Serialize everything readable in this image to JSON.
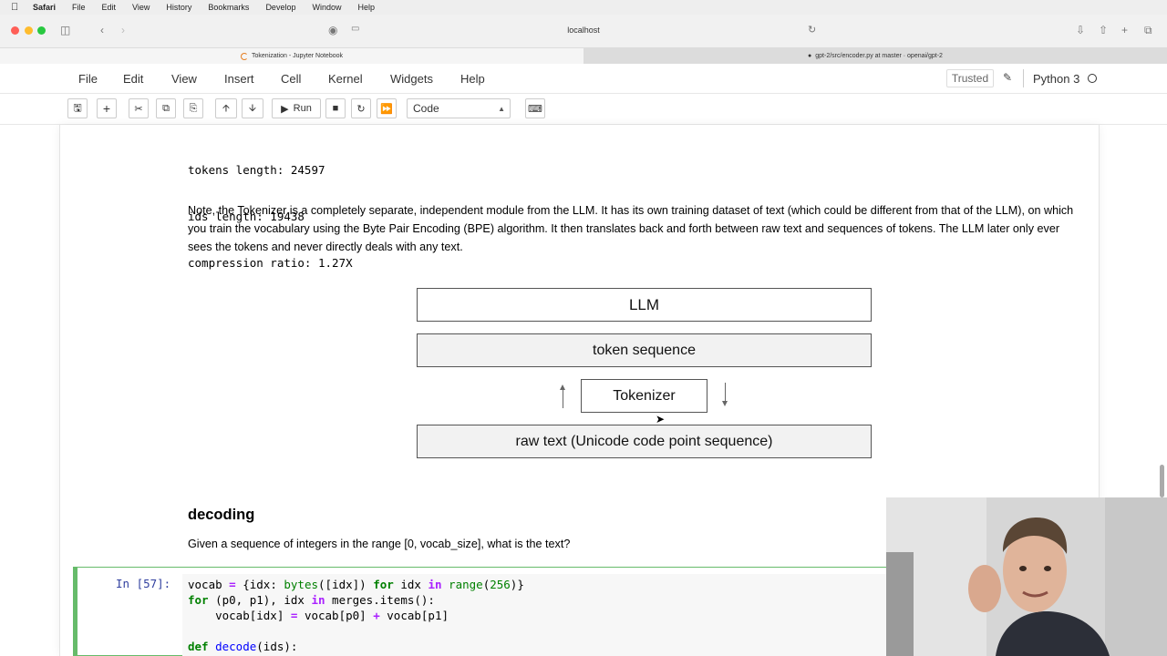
{
  "menubar": {
    "app": "Safari",
    "items": [
      "File",
      "Edit",
      "View",
      "History",
      "Bookmarks",
      "Develop",
      "Window",
      "Help"
    ]
  },
  "browser": {
    "url": "localhost",
    "tabs": [
      {
        "title": "Tokenization - Jupyter Notebook"
      },
      {
        "title": "gpt-2/src/encoder.py at master · openai/gpt-2"
      }
    ]
  },
  "jupyter": {
    "menu": [
      "File",
      "Edit",
      "View",
      "Insert",
      "Cell",
      "Kernel",
      "Widgets",
      "Help"
    ],
    "trusted": "Trusted",
    "kernel": "Python 3",
    "run_label": "Run",
    "cell_type": "Code"
  },
  "output": {
    "lines": [
      "tokens length: 24597",
      "ids length: 19438",
      "compression ratio: 1.27X"
    ]
  },
  "note": "Note, the Tokenizer is a completely separate, independent module from the LLM. It has its own training dataset of text (which could be different from that of the LLM), on which you train the vocabulary using the Byte Pair Encoding (BPE) algorithm. It then translates back and forth between raw text and sequences of tokens. The LLM later only ever sees the tokens and never directly deals with any text.",
  "diagram": {
    "llm": "LLM",
    "token_sequence": "token sequence",
    "tokenizer": "Tokenizer",
    "raw_text": "raw text (Unicode code point sequence)"
  },
  "decoding": {
    "heading": "decoding",
    "question": "Given a sequence of integers in the range [0, vocab_size], what is the text?"
  },
  "code_cell": {
    "prompt": "In [57]:"
  },
  "colors": {
    "cell_border": "#66bb6a",
    "prompt": "#303f9f",
    "code_keyword": "#008000"
  }
}
